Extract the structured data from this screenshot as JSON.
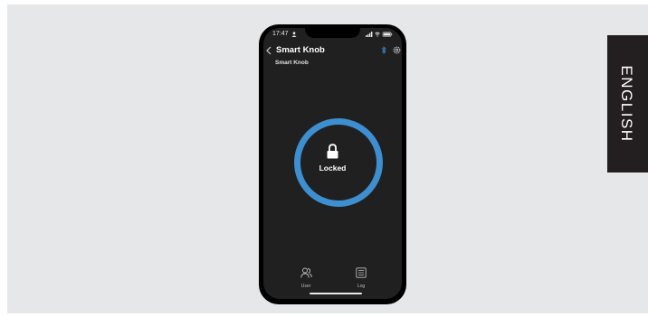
{
  "phone": {
    "status_bar": {
      "time": "17:47"
    },
    "header": {
      "title": "Smart Knob",
      "subtitle": "Smart Knob"
    },
    "lock": {
      "status": "Locked"
    },
    "bottom_nav": [
      {
        "label": "User",
        "icon": "users-icon"
      },
      {
        "label": "Log",
        "icon": "log-icon"
      }
    ]
  },
  "language_tab": {
    "label": "ENGLISH"
  },
  "colors": {
    "ring": "#3d8fd1",
    "screen_bg": "#202020",
    "panel_bg": "#e6e7e9",
    "tab_bg": "#231f20"
  }
}
